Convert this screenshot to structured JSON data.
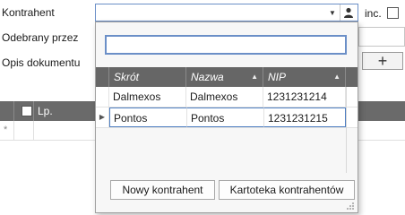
{
  "form": {
    "kontrahent_label": "Kontrahent",
    "odebrany_label": "Odebrany przez",
    "opis_label": "Opis dokumentu",
    "inc_label": "inc.",
    "inc_checked": false,
    "plus_glyph": "+"
  },
  "items_grid": {
    "lp_header": "Lp.",
    "new_row_marker": "*"
  },
  "popup": {
    "search_value": "",
    "columns": [
      "Skrót",
      "Nazwa",
      "NIP"
    ],
    "rows": [
      {
        "skrot": "Dalmexos",
        "nazwa": "Dalmexos",
        "nip": "1231231214"
      },
      {
        "skrot": "Pontos",
        "nazwa": "Pontos",
        "nip": "1231231215"
      }
    ],
    "selected_row_index": 1,
    "new_button": "Nowy kontrahent",
    "catalog_button": "Kartoteka kontrahentów"
  }
}
